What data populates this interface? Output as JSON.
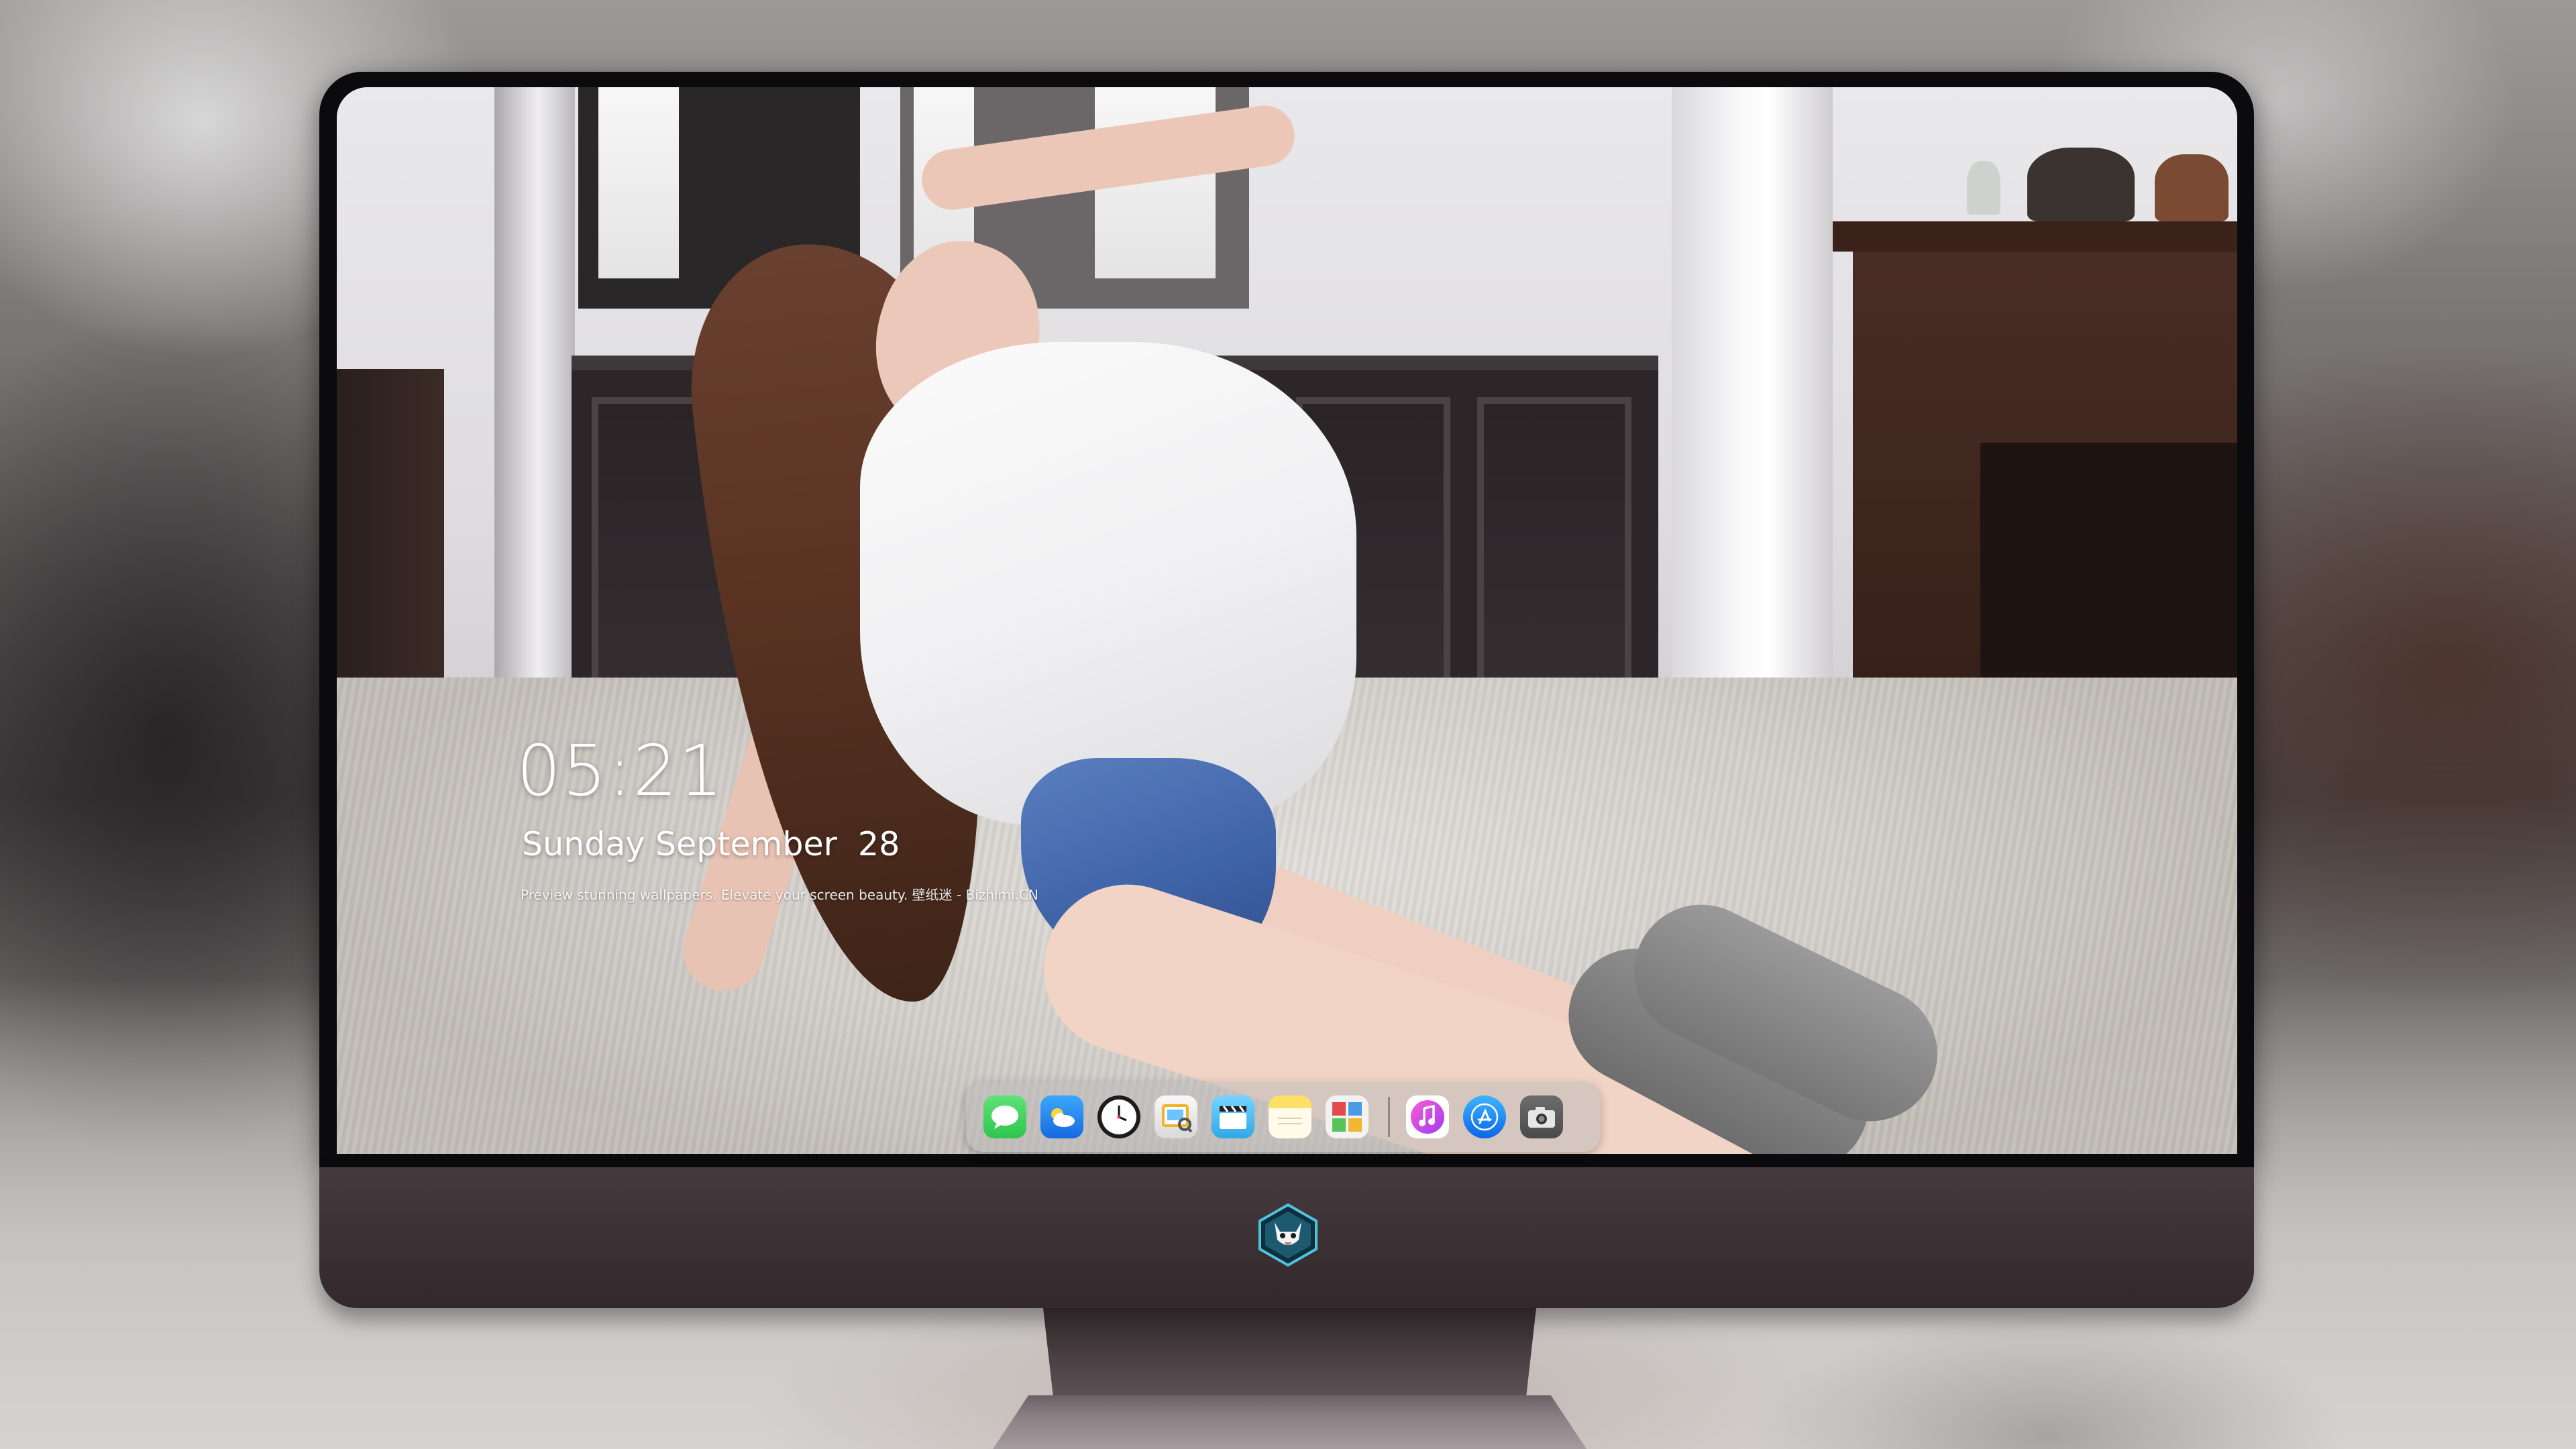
{
  "lock_screen": {
    "time": "05:21",
    "date": "Sunday September  28",
    "tagline": "Preview stunning wallpapers. Elevate your screen beauty. 壁纸迷 - Bizhimi.CN"
  },
  "dock": {
    "apps": [
      {
        "icon": "messages-icon",
        "color": "#34c759"
      },
      {
        "icon": "weather-icon",
        "color": "#1e90ff"
      },
      {
        "icon": "clock-icon",
        "color": "#1c1c1e"
      },
      {
        "icon": "preview-icon",
        "color": "#f5c542"
      },
      {
        "icon": "clips-icon",
        "color": "#5ac8fa"
      },
      {
        "icon": "notes-icon",
        "color": "#ffd84d"
      },
      {
        "icon": "photo-booth-icon",
        "color": "#e9e9e9"
      },
      {
        "icon": "itunes-icon",
        "color": "#e040fb"
      },
      {
        "icon": "app-store-icon",
        "color": "#1a8cff"
      },
      {
        "icon": "camera-icon",
        "color": "#5a5a5a"
      }
    ]
  },
  "monitor": {
    "logo": "cat-mascot-logo",
    "bezel_color": "#3a3034"
  }
}
